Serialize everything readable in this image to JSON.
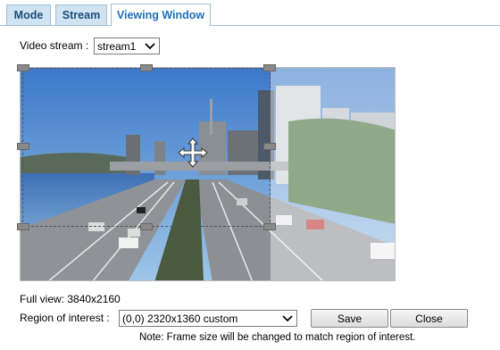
{
  "tabs": [
    {
      "label": "Mode",
      "active": false
    },
    {
      "label": "Stream",
      "active": false
    },
    {
      "label": "Viewing Window",
      "active": true
    }
  ],
  "video_stream": {
    "label": "Video stream :",
    "value": "stream1"
  },
  "full_view": "Full view: 3840x2160",
  "region": {
    "label": "Region of interest :",
    "value": "(0,0) 2320x1360 custom"
  },
  "buttons": {
    "save": "Save",
    "close": "Close"
  },
  "note": "Note: Frame size will be changed to match region of interest.",
  "colors": {
    "tab_bg": "#cfe3f2",
    "tab_text": "#1f4e79",
    "active_tab_text": "#1f6fb8"
  }
}
